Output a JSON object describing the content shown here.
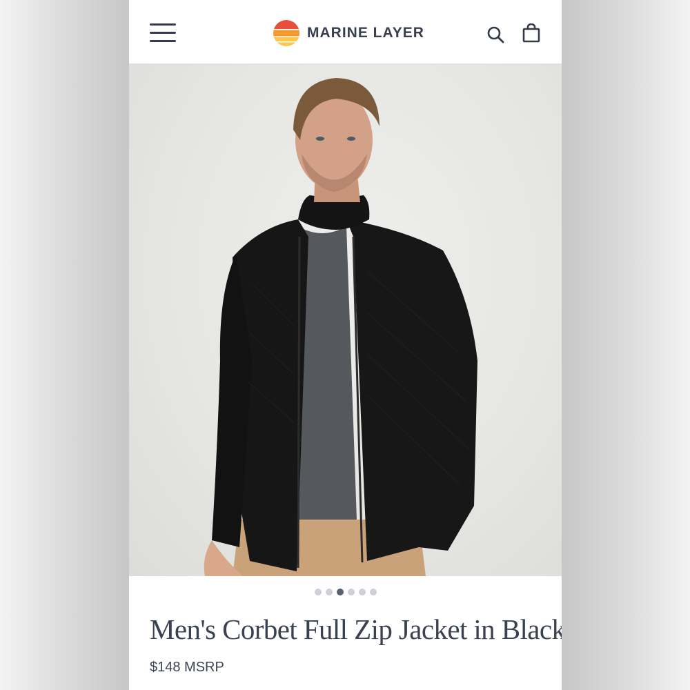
{
  "brand": {
    "name": "MARINE LAYER",
    "logo_colors": [
      "#e94e3c",
      "#f39a2b",
      "#f7c84a"
    ]
  },
  "header": {
    "menu_icon": "hamburger-menu-icon",
    "search_icon": "search-icon",
    "bag_icon": "shopping-bag-icon"
  },
  "gallery": {
    "image_count": 6,
    "active_index": 2
  },
  "product": {
    "title": "Men's Corbet Full Zip Jacket in Black",
    "price": "$148 MSRP"
  },
  "colors": {
    "text": "#3a4252",
    "dot_active": "#5b6170",
    "dot_inactive": "#cdd0d6"
  }
}
